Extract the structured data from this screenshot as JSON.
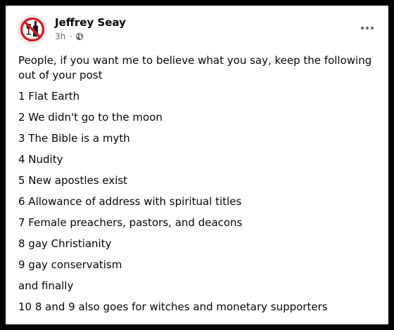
{
  "post": {
    "author": "Jeffrey Seay",
    "timestamp": "3h",
    "separator": "·",
    "audience_icon": "globe-icon",
    "avatar_icon": "no-alcohol-sign-icon",
    "more_icon": "more-horizontal-icon",
    "intro": "People, if you want me to believe what you say, keep the following out of your post",
    "lines": [
      "1 Flat Earth",
      "2 We didn't go to the moon",
      "3 The Bible is a myth",
      "4 Nudity",
      "5 New apostles exist",
      "6 Allowance of address with spiritual titles",
      "7 Female preachers, pastors, and deacons",
      "8 gay Christianity",
      "9 gay conservatism",
      "and finally",
      "10 8 and 9 also goes for witches and monetary supporters"
    ]
  },
  "colors": {
    "frame": "#000000",
    "card": "#ffffff",
    "text": "#050505",
    "secondary_text": "#65676b",
    "prohibition_red": "#d21f26"
  }
}
